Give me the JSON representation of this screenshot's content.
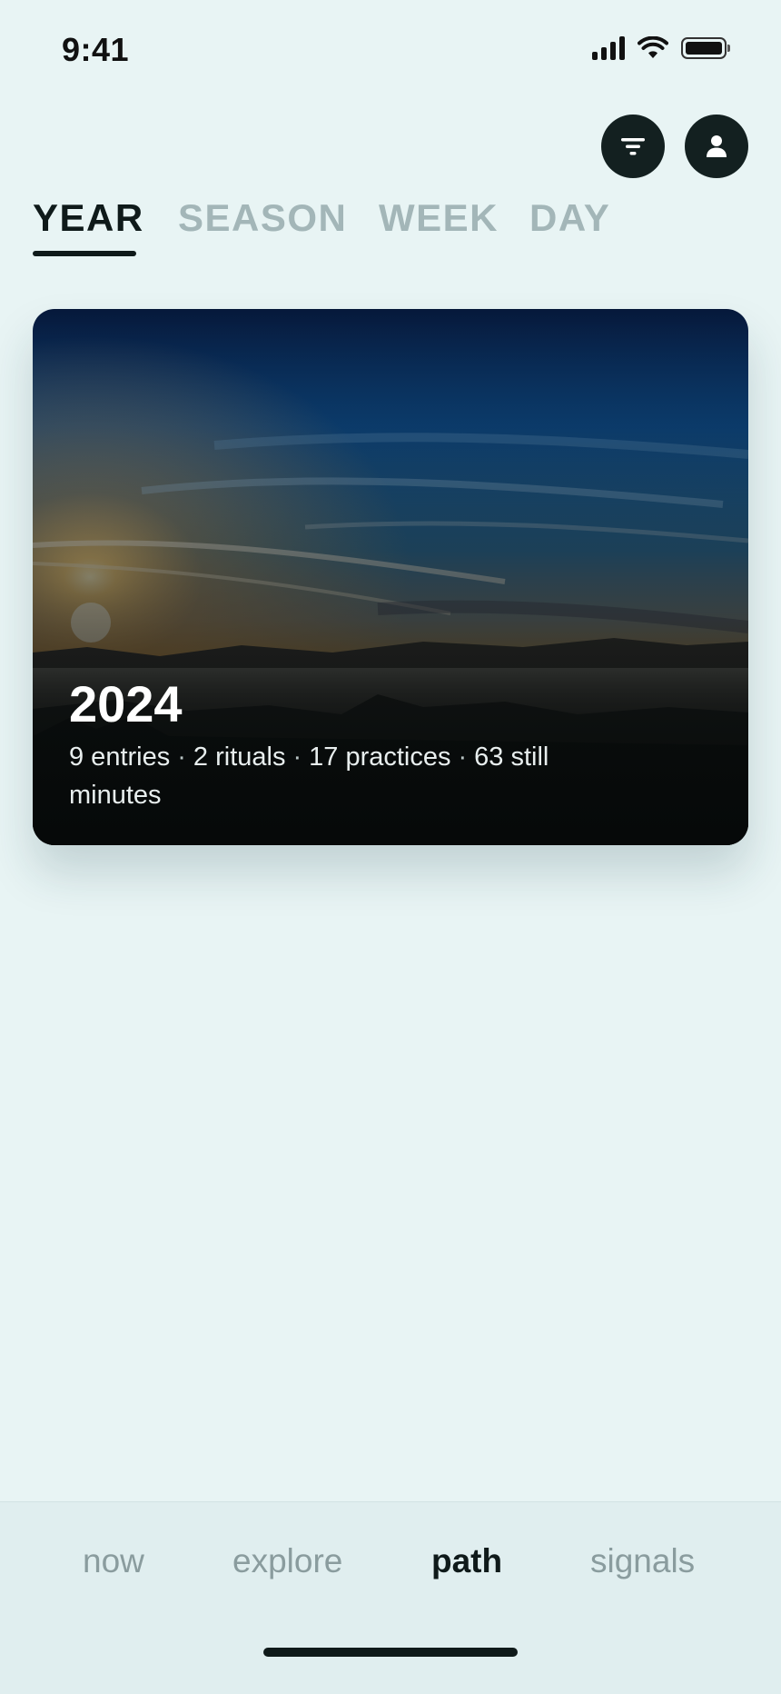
{
  "status_bar": {
    "time": "9:41",
    "icons": [
      "cellular-signal-icon",
      "wifi-icon",
      "battery-icon"
    ]
  },
  "header": {
    "filter_button_icon": "filter-icon",
    "profile_button_icon": "person-icon"
  },
  "period_tabs": [
    {
      "label": "YEAR",
      "active": true
    },
    {
      "label": "SEASON",
      "active": false
    },
    {
      "label": "WEEK",
      "active": false
    },
    {
      "label": "DAY",
      "active": false
    }
  ],
  "year_card": {
    "title": "2024",
    "stats": [
      "9 entries",
      "2 rituals",
      "17 practices",
      "63 still minutes"
    ],
    "separator": "·",
    "image": "sunrise-over-misty-hills"
  },
  "bottom_nav": [
    {
      "label": "now",
      "active": false
    },
    {
      "label": "explore",
      "active": false
    },
    {
      "label": "path",
      "active": true
    },
    {
      "label": "signals",
      "active": false
    }
  ],
  "colors": {
    "background": "#e8f4f4",
    "accent_dark": "#132020",
    "inactive_tab": "#a3b6b8",
    "inactive_nav": "#8a9c9e"
  }
}
